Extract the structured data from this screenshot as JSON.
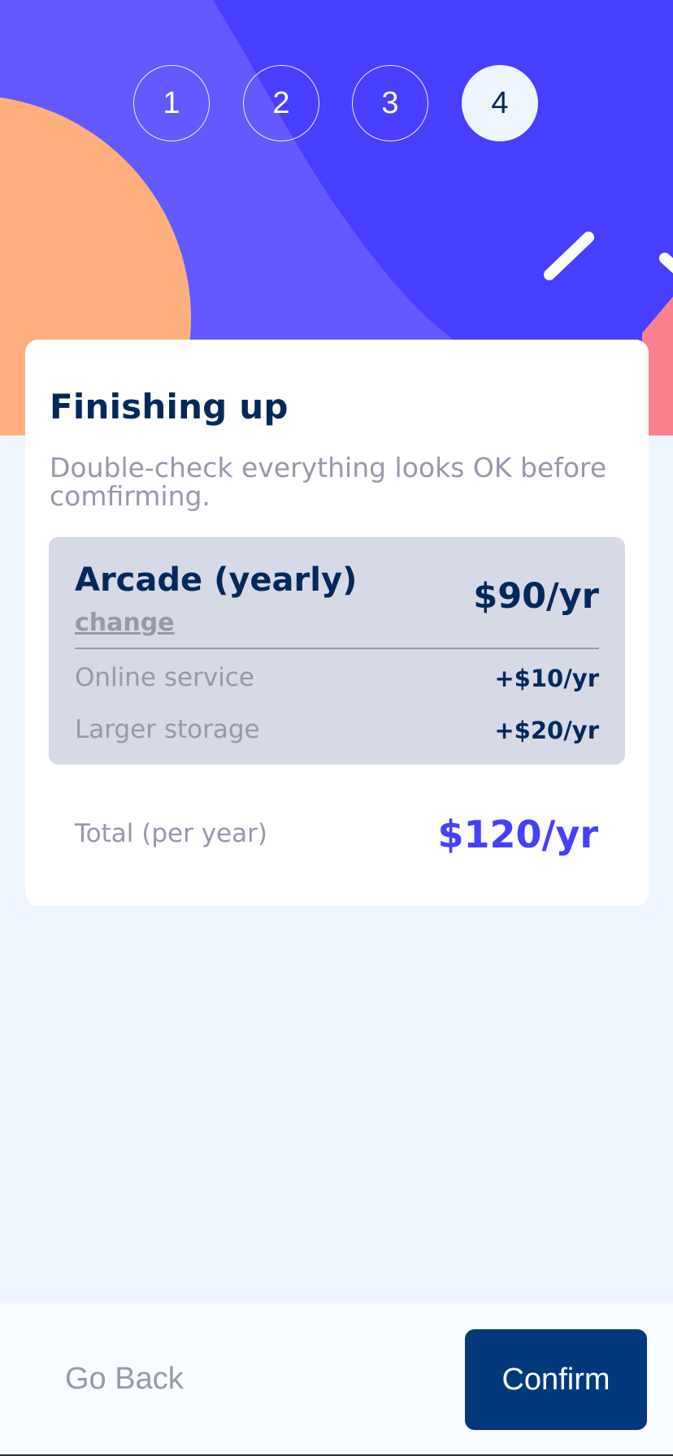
{
  "steps": [
    {
      "label": "1",
      "active": false
    },
    {
      "label": "2",
      "active": false
    },
    {
      "label": "3",
      "active": false
    },
    {
      "label": "4",
      "active": true
    }
  ],
  "card": {
    "title": "Finishing up",
    "subtitle": "Double-check everything looks OK before comfirming."
  },
  "summary": {
    "plan_name": "Arcade (yearly)",
    "change_label": "change",
    "plan_price": "$90/yr",
    "addons": [
      {
        "name": "Online service",
        "price": "+$10/yr"
      },
      {
        "name": "Larger storage",
        "price": "+$20/yr"
      }
    ]
  },
  "total": {
    "label": "Total (per year)",
    "price": "$120/yr"
  },
  "footer": {
    "back_label": "Go Back",
    "confirm_label": "Confirm"
  },
  "colors": {
    "hero_blue": "#483eff",
    "hero_light_purple": "#6259ff",
    "hero_orange": "#ffaf7e",
    "hero_pink": "#f9818e",
    "marine_blue": "#02295a",
    "confirm_button": "#02397c",
    "cool_gray": "#9699ab",
    "light_gray": "#d6d9e6",
    "background": "#eef5ff"
  }
}
